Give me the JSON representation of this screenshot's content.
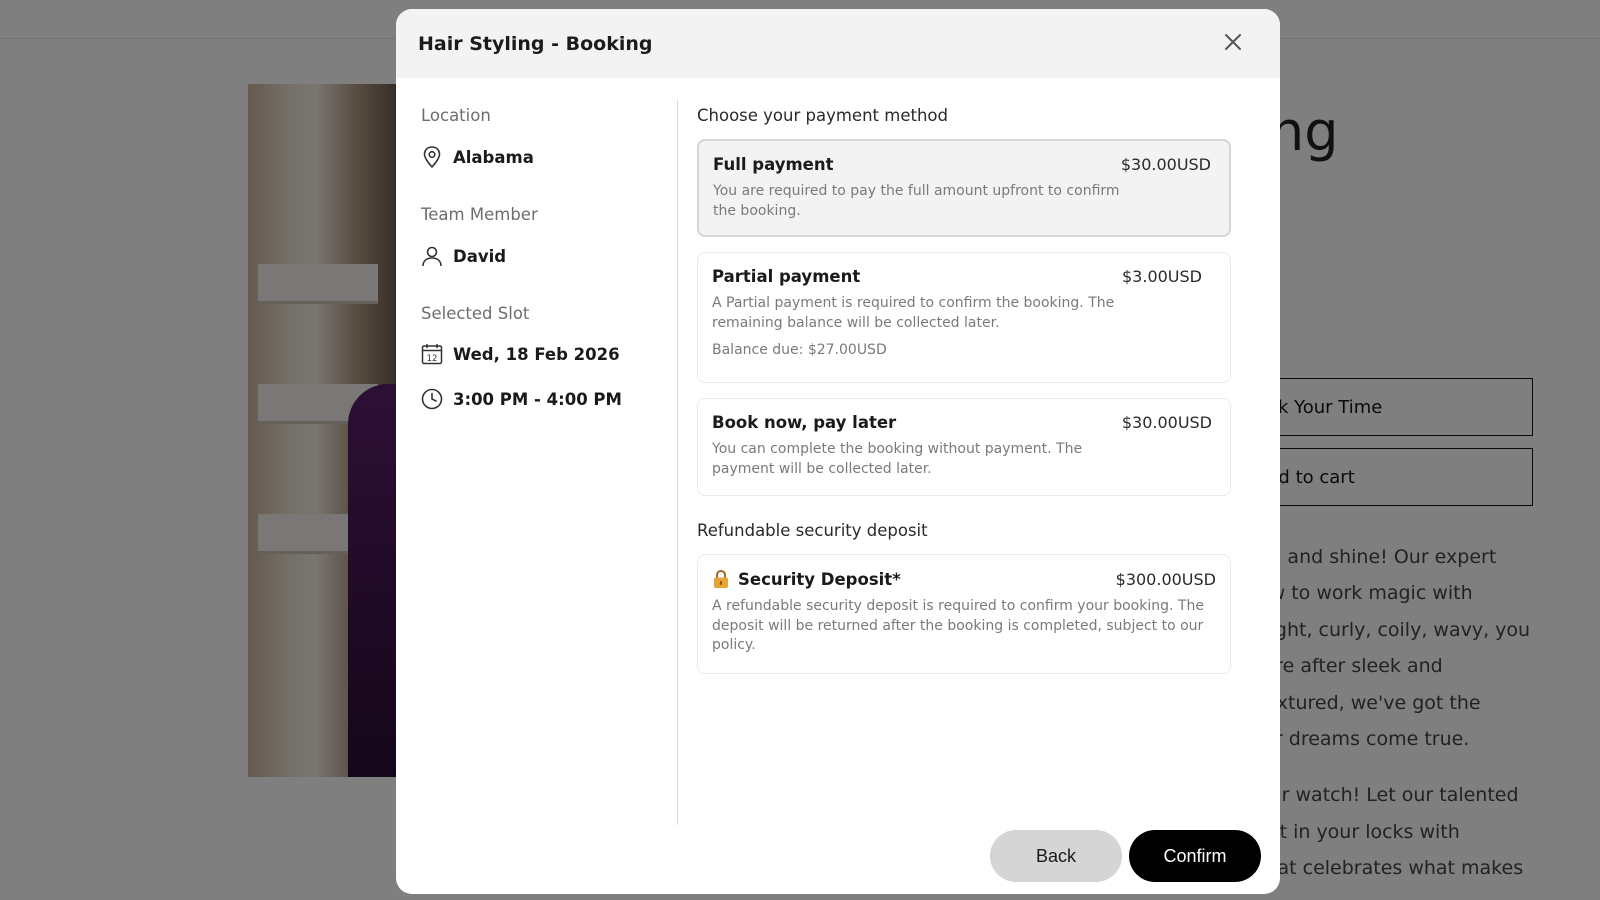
{
  "background": {
    "title_fragment": "ing",
    "buttons": [
      "ok Your Time",
      "dd to cart"
    ],
    "description_lines": [
      "st, and shine! Our expert",
      "ow to work magic with",
      "aight, curly, coily, wavy, you",
      "u're after sleek and",
      " textured, we've got the",
      "air dreams come true.",
      "",
      "our watch! Let our talented",
      "est in your locks with",
      " that celebrates what makes"
    ]
  },
  "modal": {
    "title": "Hair Styling - Booking",
    "left": {
      "location_label": "Location",
      "location_value": "Alabama",
      "team_label": "Team Member",
      "team_value": "David",
      "slot_label": "Selected Slot",
      "slot_date": "Wed, 18 Feb 2026",
      "slot_time": "3:00 PM - 4:00 PM",
      "calendar_day": "12"
    },
    "payment_title": "Choose your payment method",
    "payment_options": [
      {
        "name": "Full payment",
        "price": "$30.00USD",
        "description": "You are required to pay the full amount upfront to confirm the booking.",
        "selected": true
      },
      {
        "name": "Partial payment",
        "price": "$3.00USD",
        "description": "A Partial payment is required to confirm the booking. The remaining balance will be collected later.",
        "balance": "Balance due: $27.00USD",
        "selected": false
      },
      {
        "name": "Book now, pay later",
        "price": "$30.00USD",
        "description": "You can complete the booking without payment. The payment will be collected later.",
        "selected": false
      }
    ],
    "deposit_title": "Refundable security deposit",
    "deposit": {
      "icon": "lock-icon",
      "name": "Security Deposit*",
      "price": "$300.00USD",
      "description": "A refundable security deposit is required to confirm your booking. The deposit will be returned after the booking is completed, subject to our policy."
    },
    "buttons": {
      "back": "Back",
      "confirm": "Confirm"
    }
  }
}
